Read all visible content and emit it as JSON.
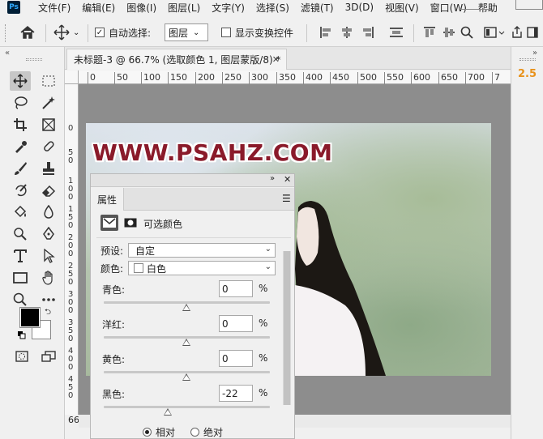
{
  "app": {
    "logo_text": "Ps"
  },
  "menu": [
    "文件(F)",
    "编辑(E)",
    "图像(I)",
    "图层(L)",
    "文字(Y)",
    "选择(S)",
    "滤镜(T)",
    "3D(D)",
    "视图(V)",
    "窗口(W)",
    "帮助"
  ],
  "options_bar": {
    "auto_select_label": "自动选择:",
    "auto_select_checked": true,
    "auto_select_target": "图层",
    "show_transform_label": "显示变换控件",
    "show_transform_checked": false
  },
  "document": {
    "tab_title": "未标题-3 @ 66.7% (选取颜色 1, 图层蒙版/8) *",
    "zoom": "66.67",
    "watermark": "WWW.PSAHZ.COM"
  },
  "ruler": {
    "h_ticks": [
      "0",
      "50",
      "100",
      "150",
      "200",
      "250",
      "300",
      "350",
      "400",
      "450",
      "500",
      "550",
      "600",
      "650",
      "700",
      "7"
    ],
    "v_ticks": [
      "0",
      "5 0",
      "1 0 0",
      "1 5 0",
      "2 0 0",
      "2 5 0",
      "3 0 0",
      "3 5 0",
      "4 0 0",
      "4 5 0"
    ]
  },
  "right_panel": {
    "version": "2.5"
  },
  "properties": {
    "tab_label": "属性",
    "adjustment_title": "可选颜色",
    "preset_label": "预设:",
    "preset_value": "自定",
    "colors_label": "颜色:",
    "colors_value": "白色",
    "sliders": [
      {
        "label": "青色:",
        "value": "0",
        "unit": "%"
      },
      {
        "label": "洋红:",
        "value": "0",
        "unit": "%"
      },
      {
        "label": "黄色:",
        "value": "0",
        "unit": "%"
      },
      {
        "label": "黑色:",
        "value": "-22",
        "unit": "%"
      }
    ],
    "method_relative": "相对",
    "method_absolute": "绝对",
    "method_selected": "相对"
  }
}
